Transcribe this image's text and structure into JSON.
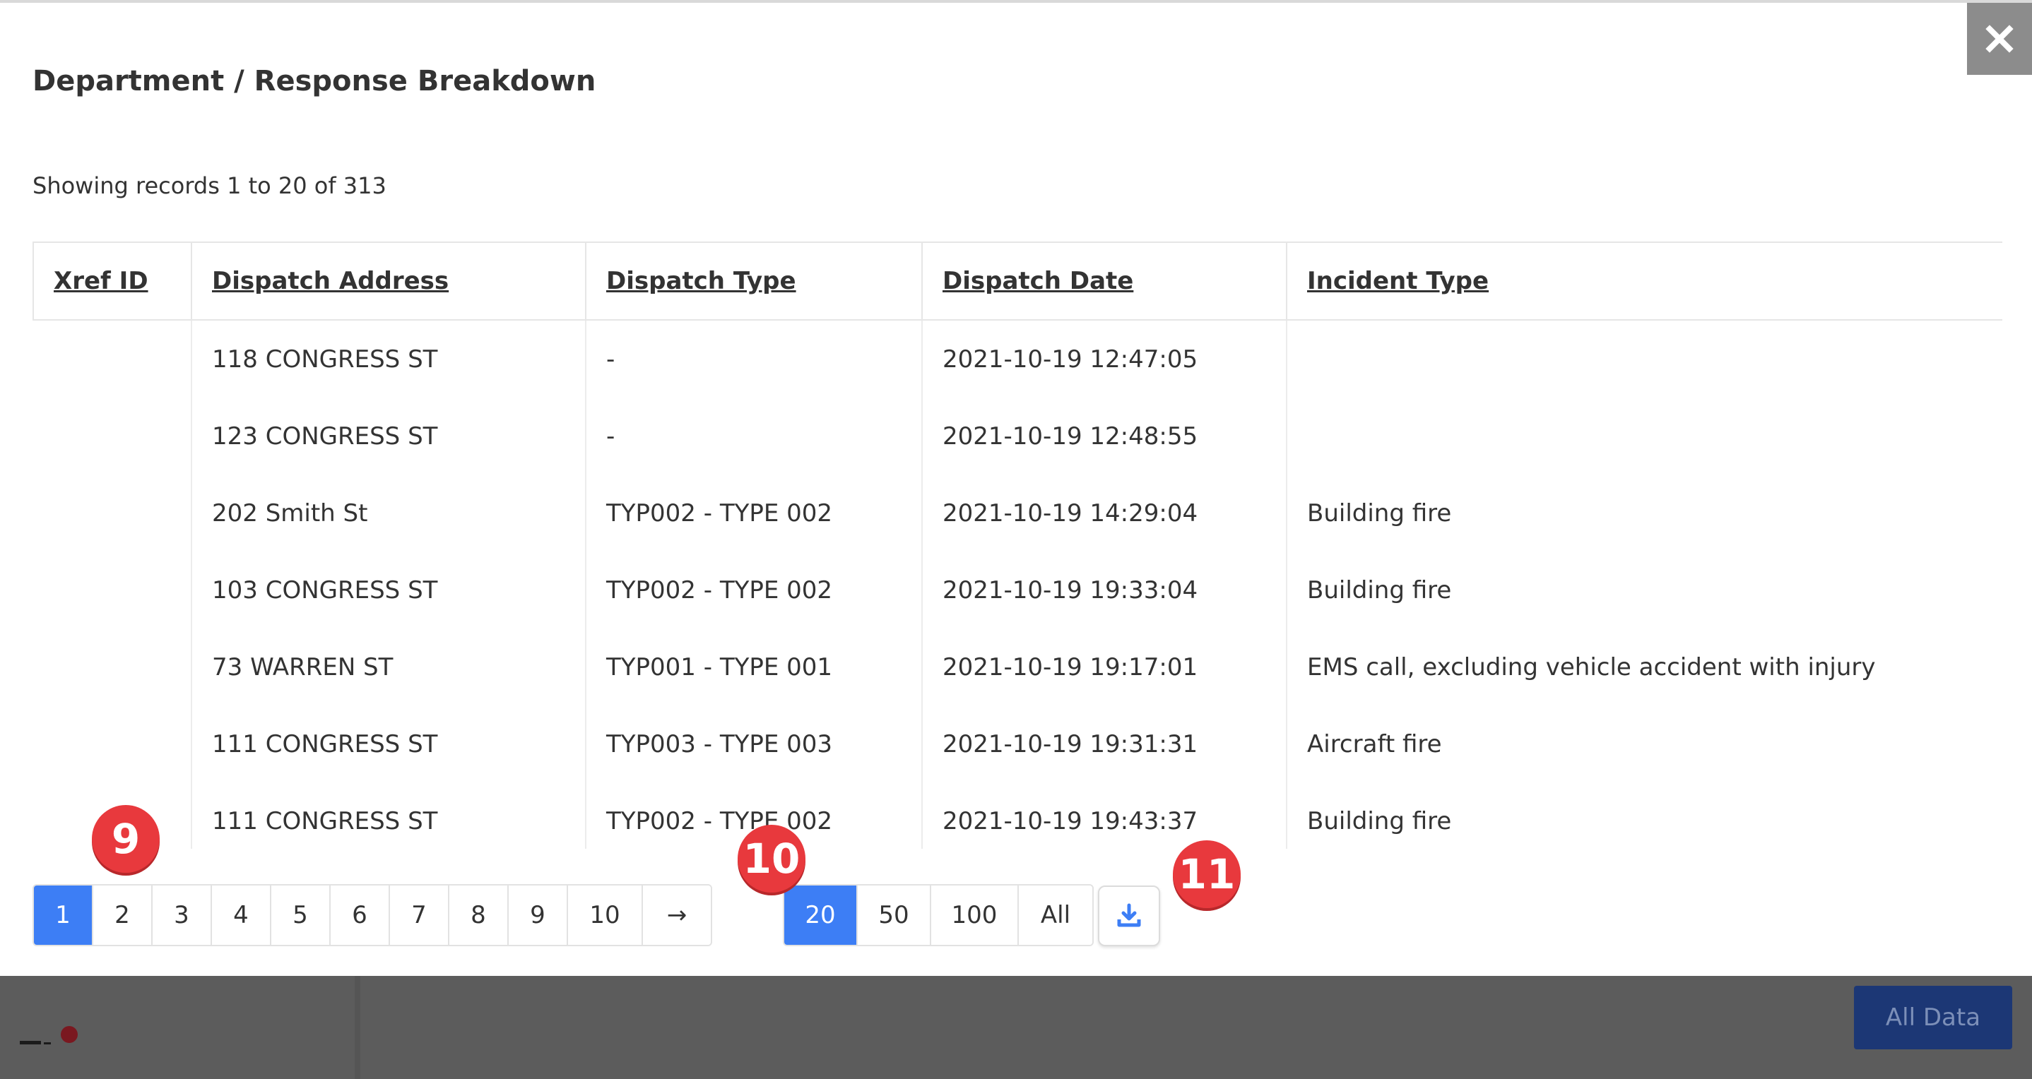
{
  "modal": {
    "title": "Department / Response Breakdown",
    "records_info": "Showing records 1 to 20 of 313"
  },
  "table": {
    "columns": [
      "Xref ID",
      "Dispatch Address",
      "Dispatch Type",
      "Dispatch Date",
      "Incident Type"
    ],
    "rows": [
      [
        "",
        "118 CONGRESS ST",
        "-",
        "2021-10-19 12:47:05",
        ""
      ],
      [
        "",
        "123 CONGRESS ST",
        "-",
        "2021-10-19 12:48:55",
        ""
      ],
      [
        "",
        "202 Smith St",
        "TYP002 - TYPE 002",
        "2021-10-19 14:29:04",
        "Building fire"
      ],
      [
        "",
        "103 CONGRESS ST",
        "TYP002 - TYPE 002",
        "2021-10-19 19:33:04",
        "Building fire"
      ],
      [
        "",
        "73 WARREN ST",
        "TYP001 - TYPE 001",
        "2021-10-19 19:17:01",
        "EMS call, excluding vehicle accident with injury"
      ],
      [
        "",
        "111 CONGRESS ST",
        "TYP003 - TYPE 003",
        "2021-10-19 19:31:31",
        "Aircraft fire"
      ],
      [
        "",
        "111 CONGRESS ST",
        "TYP002 - TYPE 002",
        "2021-10-19 19:43:37",
        "Building fire"
      ]
    ]
  },
  "pagination": {
    "pages": [
      "1",
      "2",
      "3",
      "4",
      "5",
      "6",
      "7",
      "8",
      "9",
      "10"
    ],
    "next_label": "→",
    "active_page": "1"
  },
  "per_page": {
    "options": [
      "20",
      "50",
      "100",
      "All"
    ],
    "active": "20"
  },
  "badges": {
    "pagination": "9",
    "per_page": "10",
    "download": "11"
  },
  "footer": {
    "all_data_label": "All Data"
  },
  "icons": {
    "close": "close-icon",
    "download": "download-icon"
  },
  "colors": {
    "accent": "#3d7ef5",
    "badge": "#e8393d",
    "footer_button": "#1c3775"
  }
}
